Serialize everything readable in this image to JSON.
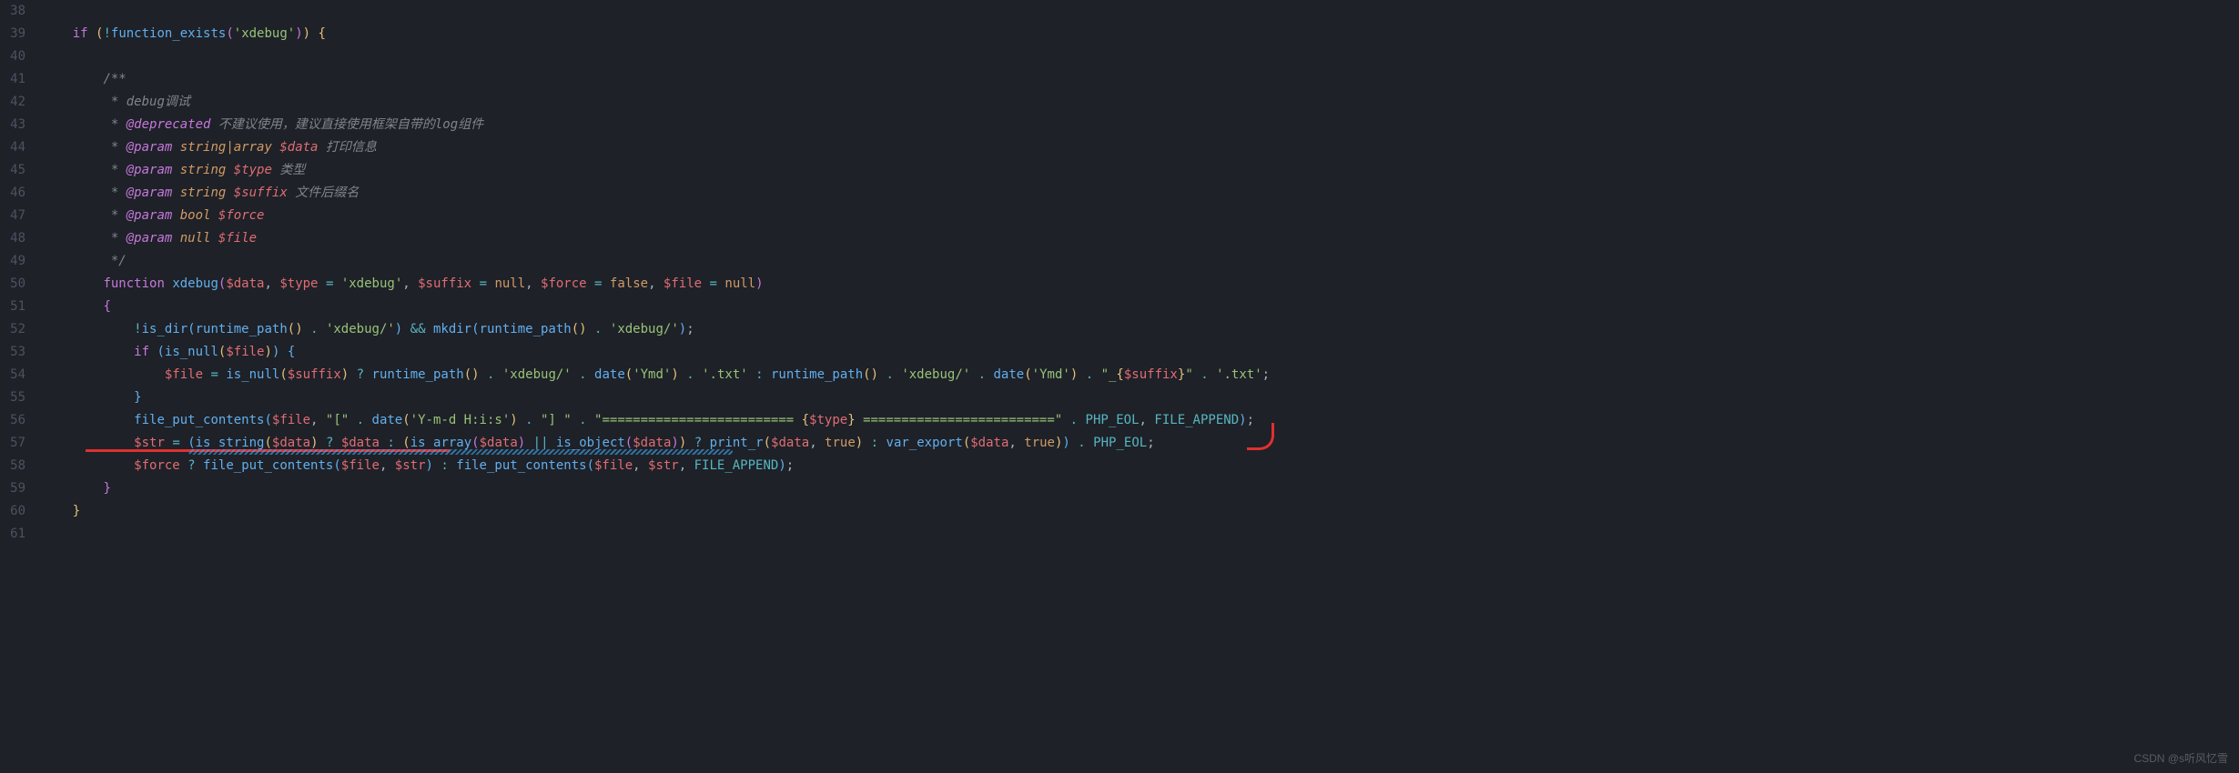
{
  "gutter": {
    "start": 38,
    "end": 61
  },
  "code": {
    "lines": [
      {
        "n": 38,
        "html": ""
      },
      {
        "n": 39,
        "html": "<span class='c-keyword'>if</span> <span class='c-brace'>(</span><span class='c-op'>!</span><span class='c-func'>function_exists</span><span class='c-brace2'>(</span><span class='c-str'>'xdebug'</span><span class='c-brace2'>)</span><span class='c-brace'>)</span> <span class='c-brace'>{</span>",
        "indent": 1
      },
      {
        "n": 40,
        "html": "",
        "indent": 1
      },
      {
        "n": 41,
        "html": "<span class='c-comment'>/**</span>",
        "indent": 2
      },
      {
        "n": 42,
        "html": "<span class='c-comment'> * debug调试</span>",
        "indent": 2
      },
      {
        "n": 43,
        "html": "<span class='c-comment'> * <span class='c-tag'>@deprecated</span> 不建议使用，建议直接使用框架自带的log组件</span>",
        "indent": 2
      },
      {
        "n": 44,
        "html": "<span class='c-comment'> * <span class='c-tag'>@param</span> <span class='c-param'>string|array</span> <span class='c-var'>$data</span> 打印信息</span>",
        "indent": 2
      },
      {
        "n": 45,
        "html": "<span class='c-comment'> * <span class='c-tag'>@param</span> <span class='c-param'>string</span> <span class='c-var'>$type</span> 类型</span>",
        "indent": 2
      },
      {
        "n": 46,
        "html": "<span class='c-comment'> * <span class='c-tag'>@param</span> <span class='c-param'>string</span> <span class='c-var'>$suffix</span> 文件后缀名</span>",
        "indent": 2
      },
      {
        "n": 47,
        "html": "<span class='c-comment'> * <span class='c-tag'>@param</span> <span class='c-param'>bool</span> <span class='c-var'>$force</span></span>",
        "indent": 2
      },
      {
        "n": 48,
        "html": "<span class='c-comment'> * <span class='c-tag'>@param</span> <span class='c-param'>null</span> <span class='c-var'>$file</span></span>",
        "indent": 2
      },
      {
        "n": 49,
        "html": "<span class='c-comment'> */</span>",
        "indent": 2
      },
      {
        "n": 50,
        "html": "<span class='c-keyword'>function</span> <span class='c-func'>xdebug</span><span class='c-brace2'>(</span><span class='c-var'>$data</span>, <span class='c-var'>$type</span> <span class='c-op'>=</span> <span class='c-str'>'xdebug'</span>, <span class='c-var'>$suffix</span> <span class='c-op'>=</span> <span class='c-bool'>null</span>, <span class='c-var'>$force</span> <span class='c-op'>=</span> <span class='c-bool'>false</span>, <span class='c-var'>$file</span> <span class='c-op'>=</span> <span class='c-bool'>null</span><span class='c-brace2'>)</span>",
        "indent": 2
      },
      {
        "n": 51,
        "html": "<span class='c-brace2'>{</span>",
        "indent": 2
      },
      {
        "n": 52,
        "html": "<span class='c-op'>!</span><span class='c-func'>is_dir</span><span class='c-brace3'>(</span><span class='c-func'>runtime_path</span><span class='c-brace'>()</span> <span class='c-op'>.</span> <span class='c-str'>'xdebug/'</span><span class='c-brace3'>)</span> <span class='c-op'>&amp;&amp;</span> <span class='c-func'>mkdir</span><span class='c-brace3'>(</span><span class='c-func'>runtime_path</span><span class='c-brace'>()</span> <span class='c-op'>.</span> <span class='c-str'>'xdebug/'</span><span class='c-brace3'>)</span>;",
        "indent": 3
      },
      {
        "n": 53,
        "html": "<span class='c-keyword'>if</span> <span class='c-brace3'>(</span><span class='c-func'>is_null</span><span class='c-brace'>(</span><span class='c-var'>$file</span><span class='c-brace'>)</span><span class='c-brace3'>)</span> <span class='c-brace3'>{</span>",
        "indent": 3
      },
      {
        "n": 54,
        "html": "<span class='c-var'>$file</span> <span class='c-op'>=</span> <span class='c-func'>is_null</span><span class='c-brace'>(</span><span class='c-var'>$suffix</span><span class='c-brace'>)</span> <span class='c-op'>?</span> <span class='c-func'>runtime_path</span><span class='c-brace'>()</span> <span class='c-op'>.</span> <span class='c-str'>'xdebug/'</span> <span class='c-op'>.</span> <span class='c-func'>date</span><span class='c-brace'>(</span><span class='c-str'>'Ymd'</span><span class='c-brace'>)</span> <span class='c-op'>.</span> <span class='c-str'>'.txt'</span> <span class='c-op'>:</span> <span class='c-func'>runtime_path</span><span class='c-brace'>()</span> <span class='c-op'>.</span> <span class='c-str'>'xdebug/'</span> <span class='c-op'>.</span> <span class='c-func'>date</span><span class='c-brace'>(</span><span class='c-str'>'Ymd'</span><span class='c-brace'>)</span> <span class='c-op'>.</span> <span class='c-str'>\"_</span><span class='c-brace'>{</span><span class='c-var'>$suffix</span><span class='c-brace'>}</span><span class='c-str'>\"</span> <span class='c-op'>.</span> <span class='c-str'>'.txt'</span>;",
        "indent": 4
      },
      {
        "n": 55,
        "html": "<span class='c-brace3'>}</span>",
        "indent": 3
      },
      {
        "n": 56,
        "html": "<span class='c-func'>file_put_contents</span><span class='c-brace3'>(</span><span class='c-var'>$file</span>, <span class='c-str'>\"[\"</span> <span class='c-op'>.</span> <span class='c-func'>date</span><span class='c-brace'>(</span><span class='c-str'>'Y-m-d H:i:s'</span><span class='c-brace'>)</span> <span class='c-op'>.</span> <span class='c-str'>\"] \"</span> <span class='c-op'>.</span> <span class='c-str'>\"========================= </span><span class='c-brace'>{</span><span class='c-var'>$type</span><span class='c-brace'>}</span><span class='c-str'> =========================\"</span> <span class='c-op'>.</span> <span class='c-const'>PHP_EOL</span>, <span class='c-const'>FILE_APPEND</span><span class='c-brace3'>)</span>;",
        "indent": 3
      },
      {
        "n": 57,
        "html": "<span class='c-var'>$str</span> <span class='c-op'>=</span> <span class='c-brace3'>(</span><span class='c-func'>is_string</span><span class='c-brace'>(</span><span class='c-var'>$data</span><span class='c-brace'>)</span> <span class='c-op'>?</span> <span class='c-var'>$data</span> <span class='c-op'>:</span> <span class='c-brace'>(</span><span class='c-func'>is_array</span><span class='c-brace2'>(</span><span class='c-var'>$data</span><span class='c-brace2'>)</span> <span class='c-op'>||</span> <span class='c-func'>is_object</span><span class='c-brace2'>(</span><span class='c-var'>$data</span><span class='c-brace2'>)</span><span class='c-brace'>)</span> <span class='c-op'>?</span> <span class='c-func'>print_r</span><span class='c-brace'>(</span><span class='c-var'>$data</span>, <span class='c-bool'>true</span><span class='c-brace'>)</span> <span class='c-op'>:</span> <span class='c-func'>var_export</span><span class='c-brace'>(</span><span class='c-var'>$data</span>, <span class='c-bool'>true</span><span class='c-brace'>)</span><span class='c-brace3'>)</span> <span class='c-op'>.</span> <span class='c-const'>PHP_EOL</span>;",
        "indent": 3
      },
      {
        "n": 58,
        "html": "<span class='c-var'>$force</span> <span class='c-op'>?</span> <span class='c-func'>file_put_contents</span><span class='c-brace3'>(</span><span class='c-var'>$file</span>, <span class='c-var'>$str</span><span class='c-brace3'>)</span> <span class='c-op'>:</span> <span class='c-func'>file_put_contents</span><span class='c-brace3'>(</span><span class='c-var'>$file</span>, <span class='c-var'>$str</span>, <span class='c-const'>FILE_APPEND</span><span class='c-brace3'>)</span>;",
        "indent": 3
      },
      {
        "n": 59,
        "html": "<span class='c-brace2'>}</span>",
        "indent": 2
      },
      {
        "n": 60,
        "html": "<span class='c-brace'>}</span>",
        "indent": 1
      },
      {
        "n": 61,
        "html": "",
        "indent": 0
      }
    ]
  },
  "watermark": "CSDN @s听风忆雪"
}
